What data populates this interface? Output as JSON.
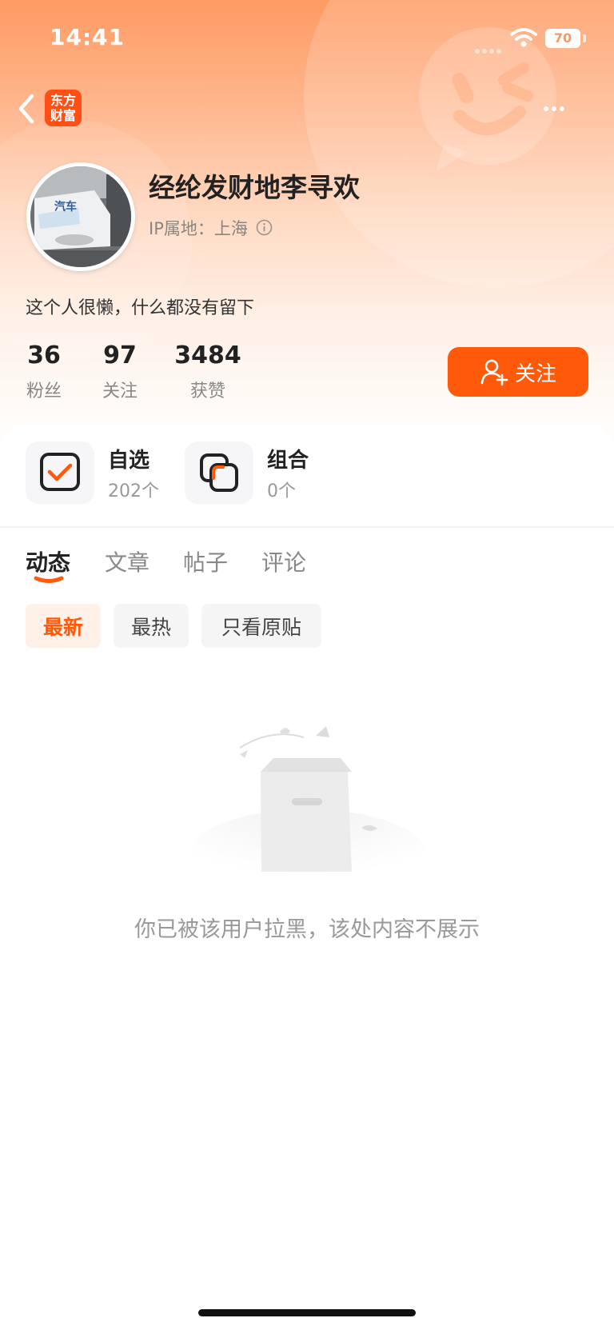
{
  "status_bar": {
    "time": "14:41",
    "battery": "70"
  },
  "nav": {
    "app_logo_line1": "东方",
    "app_logo_line2": "财富",
    "back_icon": "chevron-left-icon",
    "more_icon": "more-horizontal-icon"
  },
  "profile": {
    "username": "经纶发财地李寻欢",
    "ip_location": "IP属地：上海",
    "bio": "这个人很懒，什么都没有留下",
    "avatar_text": "汽车"
  },
  "stats": [
    {
      "value": "36",
      "label": "粉丝"
    },
    {
      "value": "97",
      "label": "关注"
    },
    {
      "value": "3484",
      "label": "获赞"
    }
  ],
  "follow_button": {
    "label": "关注"
  },
  "shortcuts": [
    {
      "title": "自选",
      "subtitle": "202个",
      "icon": "checkbox-icon"
    },
    {
      "title": "组合",
      "subtitle": "0个",
      "icon": "portfolio-icon"
    }
  ],
  "tabs": [
    {
      "label": "动态",
      "active": true
    },
    {
      "label": "文章",
      "active": false
    },
    {
      "label": "帖子",
      "active": false
    },
    {
      "label": "评论",
      "active": false
    }
  ],
  "filters": [
    {
      "label": "最新",
      "active": true
    },
    {
      "label": "最热",
      "active": false
    },
    {
      "label": "只看原贴",
      "active": false
    }
  ],
  "empty_state": {
    "message": "你已被该用户拉黑，该处内容不展示"
  },
  "colors": {
    "accent": "#ff5a0a",
    "header_top": "#ff9a63",
    "muted_text": "#999999"
  }
}
